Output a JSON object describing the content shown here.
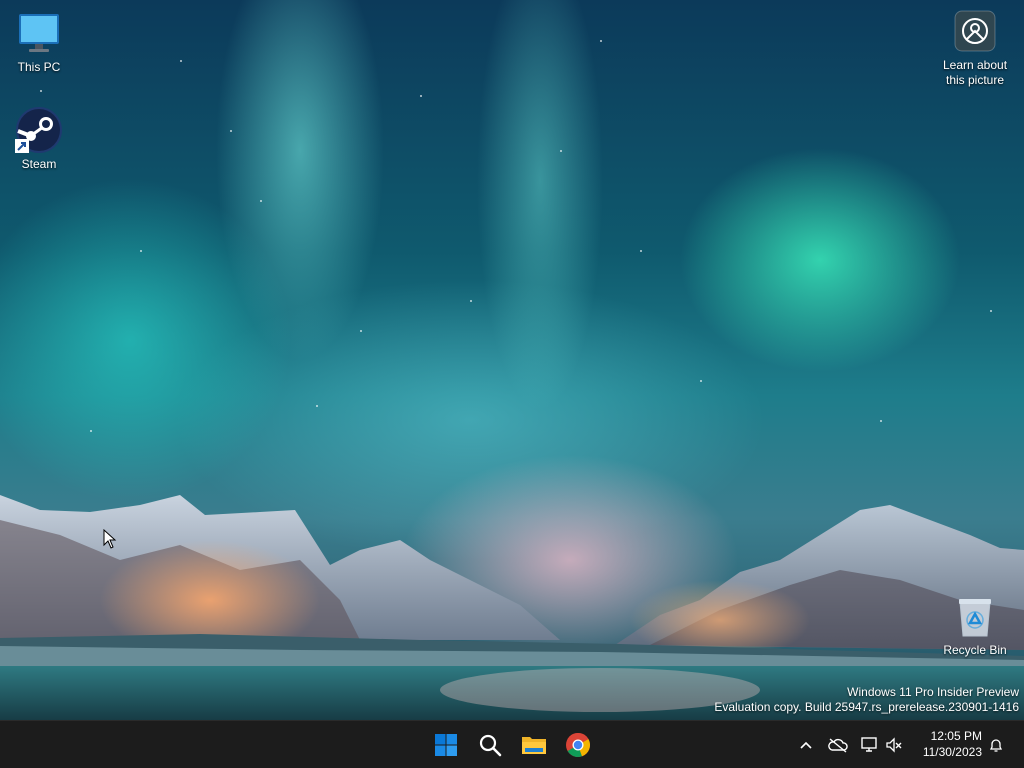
{
  "desktop": {
    "icons": [
      {
        "label": "This PC",
        "icon": "monitor-icon"
      },
      {
        "label": "Steam",
        "icon": "steam-icon"
      },
      {
        "label": "Learn about this picture",
        "icon": "camera-icon"
      },
      {
        "label": "Recycle Bin",
        "icon": "recycle-bin-icon"
      }
    ]
  },
  "watermark": {
    "line1": "Windows 11 Pro Insider Preview",
    "line2": "Evaluation copy. Build 25947.rs_prerelease.230901-1416"
  },
  "taskbar": {
    "apps": [
      {
        "name": "Start",
        "icon": "windows-start-icon"
      },
      {
        "name": "Search",
        "icon": "search-icon"
      },
      {
        "name": "File Explorer",
        "icon": "folder-icon"
      },
      {
        "name": "Google Chrome",
        "icon": "chrome-icon"
      }
    ],
    "tray": {
      "icons": [
        "chevron-up-icon",
        "onedrive-icon",
        "network-icon",
        "volume-muted-icon",
        "bell-icon"
      ],
      "time": "12:05 PM",
      "date": "11/30/2023"
    }
  },
  "colors": {
    "taskbar_bg": "#1c1c1c",
    "start_blue": "#0a78d7",
    "folder_yellow": "#f0b429"
  }
}
